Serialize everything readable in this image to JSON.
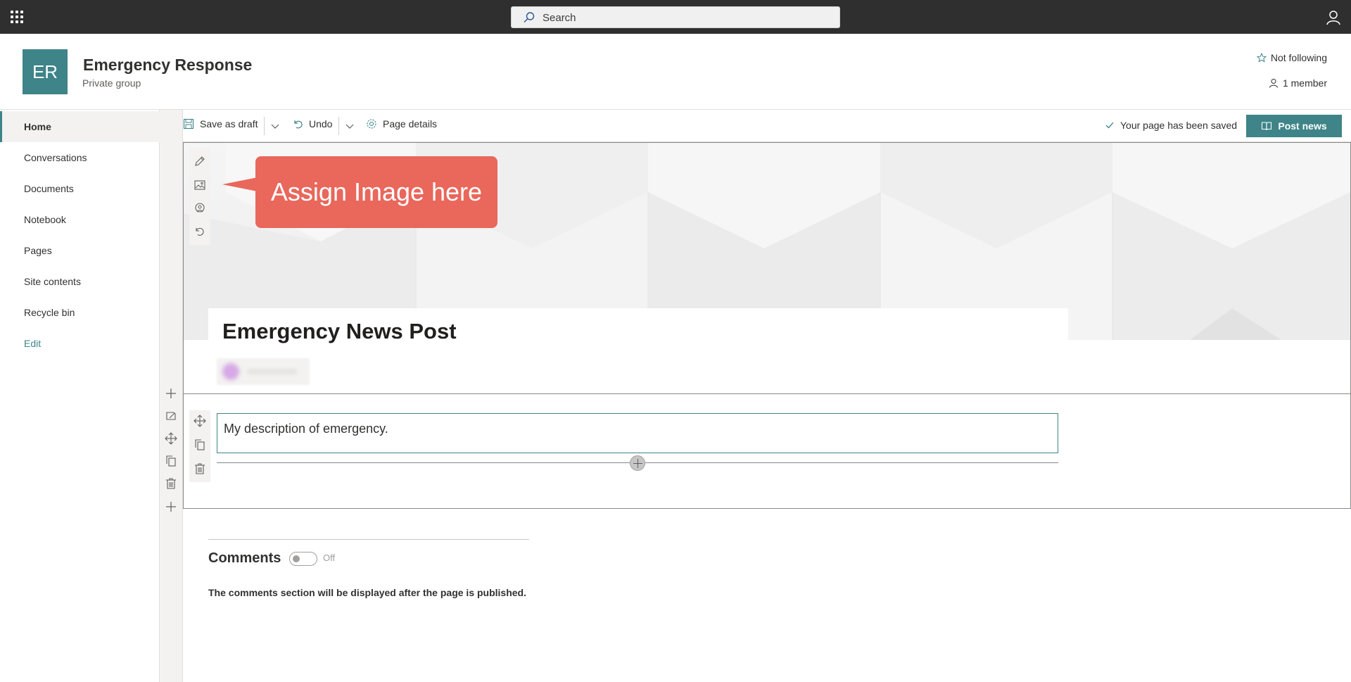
{
  "suitebar": {
    "search_placeholder": "Search"
  },
  "site": {
    "logo_text": "ER",
    "title": "Emergency Response",
    "subtitle": "Private group",
    "follow_label": "Not following",
    "members_label": "1 member"
  },
  "nav": {
    "items": [
      {
        "label": "Home",
        "active": true
      },
      {
        "label": "Conversations"
      },
      {
        "label": "Documents"
      },
      {
        "label": "Notebook"
      },
      {
        "label": "Pages"
      },
      {
        "label": "Site contents"
      },
      {
        "label": "Recycle bin"
      }
    ],
    "edit_label": "Edit"
  },
  "commandbar": {
    "save_draft_label": "Save as draft",
    "undo_label": "Undo",
    "page_details_label": "Page details",
    "saved_status": "Your page has been saved",
    "post_news_label": "Post news"
  },
  "page": {
    "callout_text": "Assign Image here",
    "title": "Emergency News Post",
    "text_part": "My description of emergency."
  },
  "comments": {
    "title": "Comments",
    "toggle_state": "Off",
    "note": "The comments section will be displayed after the page is published."
  },
  "colors": {
    "accent": "#3e8489",
    "callout": "#e9675b",
    "suitebar": "#2f2f2f"
  }
}
